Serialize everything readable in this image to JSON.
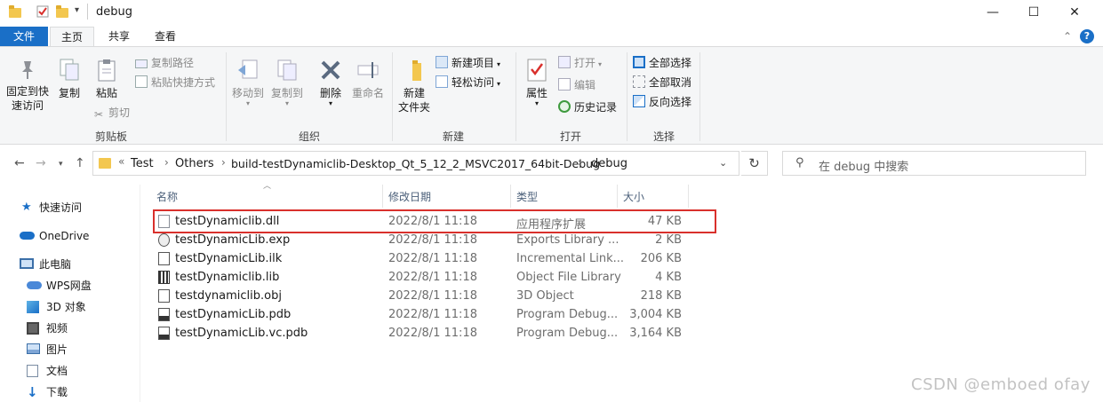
{
  "window": {
    "title": "debug",
    "controls": {
      "minimize": "—",
      "maximize": "☐",
      "close": "✕"
    }
  },
  "ribbon_tabs": [
    "文件",
    "主页",
    "共享",
    "查看"
  ],
  "ribbon": {
    "clipboard": {
      "group_label": "剪贴板",
      "pin": "固定到快速访问",
      "pin_line1": "固定到快",
      "pin_line2": "速访问",
      "copy": "复制",
      "paste": "粘贴",
      "copy_path": "复制路径",
      "paste_shortcut": "粘贴快捷方式",
      "cut": "剪切"
    },
    "organize": {
      "group_label": "组织",
      "move_to": "移动到",
      "copy_to": "复制到",
      "delete": "删除",
      "rename": "重命名"
    },
    "new": {
      "group_label": "新建",
      "new_folder_line1": "新建",
      "new_folder_line2": "文件夹",
      "new_item": "新建项目",
      "easy_access": "轻松访问"
    },
    "open": {
      "group_label": "打开",
      "properties": "属性",
      "open": "打开",
      "edit": "编辑",
      "history": "历史记录"
    },
    "select": {
      "group_label": "选择",
      "select_all": "全部选择",
      "select_none": "全部取消",
      "invert": "反向选择"
    }
  },
  "address": {
    "overflow": "«",
    "breadcrumbs": [
      "Test",
      "Others",
      "build-testDynamiclib-Desktop_Qt_5_12_2_MSVC2017_64bit-Debug",
      "debug"
    ]
  },
  "search": {
    "placeholder": "在 debug 中搜索"
  },
  "nav_pane": [
    {
      "label": "快速访问",
      "icon": "star-icon"
    },
    {
      "label": "OneDrive",
      "icon": "cloud-icon"
    },
    {
      "label": "此电脑",
      "icon": "computer-icon"
    },
    {
      "label": "WPS网盘",
      "icon": "wps-cloud-icon"
    },
    {
      "label": "3D 对象",
      "icon": "cube-icon"
    },
    {
      "label": "视频",
      "icon": "video-icon"
    },
    {
      "label": "图片",
      "icon": "picture-icon"
    },
    {
      "label": "文档",
      "icon": "document-icon"
    },
    {
      "label": "下载",
      "icon": "download-icon"
    }
  ],
  "columns": [
    "名称",
    "修改日期",
    "类型",
    "大小"
  ],
  "files": [
    {
      "name": "testDynamiclib.dll",
      "date": "2022/8/1 11:18",
      "type": "应用程序扩展",
      "size": "47 KB",
      "icon": "dll-icon"
    },
    {
      "name": "testDynamicLib.exp",
      "date": "2022/8/1 11:18",
      "type": "Exports Library ...",
      "size": "2 KB",
      "icon": "exp-icon"
    },
    {
      "name": "testDynamicLib.ilk",
      "date": "2022/8/1 11:18",
      "type": "Incremental Link...",
      "size": "206 KB",
      "icon": "file-icon"
    },
    {
      "name": "testDynamiclib.lib",
      "date": "2022/8/1 11:18",
      "type": "Object File Library",
      "size": "4 KB",
      "icon": "lib-icon"
    },
    {
      "name": "testdynamiclib.obj",
      "date": "2022/8/1 11:18",
      "type": "3D Object",
      "size": "218 KB",
      "icon": "obj-icon"
    },
    {
      "name": "testDynamicLib.pdb",
      "date": "2022/8/1 11:18",
      "type": "Program Debug...",
      "size": "3,004 KB",
      "icon": "pdb-icon"
    },
    {
      "name": "testDynamicLib.vc.pdb",
      "date": "2022/8/1 11:18",
      "type": "Program Debug...",
      "size": "3,164 KB",
      "icon": "pdb-icon"
    }
  ],
  "watermark": "CSDN @emboed ofay",
  "colors": {
    "accent": "#1a6fc7",
    "highlight_border": "#d9302c"
  }
}
